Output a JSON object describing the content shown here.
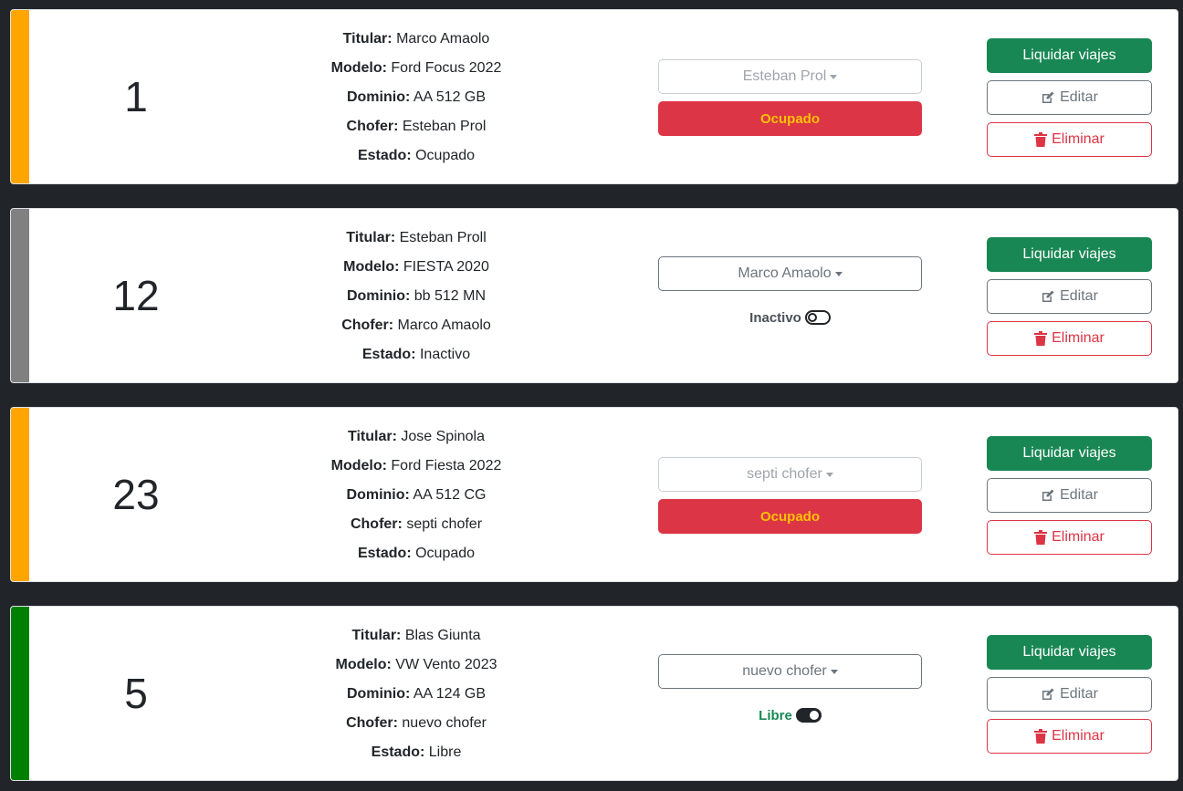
{
  "colors": {
    "ocupado_stripe": "#ffa500",
    "inactivo_stripe": "#808080",
    "libre_stripe": "#008000",
    "liquidar_bg": "#198754",
    "danger": "#dc3545",
    "warning_text": "#ffc107",
    "libre_text": "#198754"
  },
  "labels": {
    "titular": "Titular:",
    "modelo": "Modelo:",
    "dominio": "Dominio:",
    "chofer": "Chofer:",
    "estado": "Estado:",
    "liquidar": "Liquidar viajes",
    "editar": "Editar",
    "eliminar": "Eliminar"
  },
  "cards": [
    {
      "numero": "1",
      "titular": "Marco Amaolo",
      "modelo": "Ford Focus 2022",
      "dominio": "AA 512 GB",
      "chofer": "Esteban Prol",
      "estado": "Ocupado",
      "selected_driver": "Esteban Prol",
      "status_control": "button",
      "status_label": "Ocupado",
      "stripe_color": "#ffa500",
      "driver_select_disabled": true
    },
    {
      "numero": "12",
      "titular": "Esteban Proll",
      "modelo": "FIESTA 2020",
      "dominio": "bb 512 MN",
      "chofer": "Marco Amaolo",
      "estado": "Inactivo",
      "selected_driver": "Marco Amaolo",
      "status_control": "toggle-off",
      "status_label": "Inactivo",
      "stripe_color": "#808080",
      "driver_select_disabled": false
    },
    {
      "numero": "23",
      "titular": "Jose Spinola",
      "modelo": "Ford Fiesta 2022",
      "dominio": "AA 512 CG",
      "chofer": "septi chofer",
      "estado": "Ocupado",
      "selected_driver": "septi chofer",
      "status_control": "button",
      "status_label": "Ocupado",
      "stripe_color": "#ffa500",
      "driver_select_disabled": true
    },
    {
      "numero": "5",
      "titular": "Blas Giunta",
      "modelo": "VW Vento 2023",
      "dominio": "AA 124 GB",
      "chofer": "nuevo chofer",
      "estado": "Libre",
      "selected_driver": "nuevo chofer",
      "status_control": "toggle-on",
      "status_label": "Libre",
      "stripe_color": "#008000",
      "driver_select_disabled": false
    }
  ]
}
